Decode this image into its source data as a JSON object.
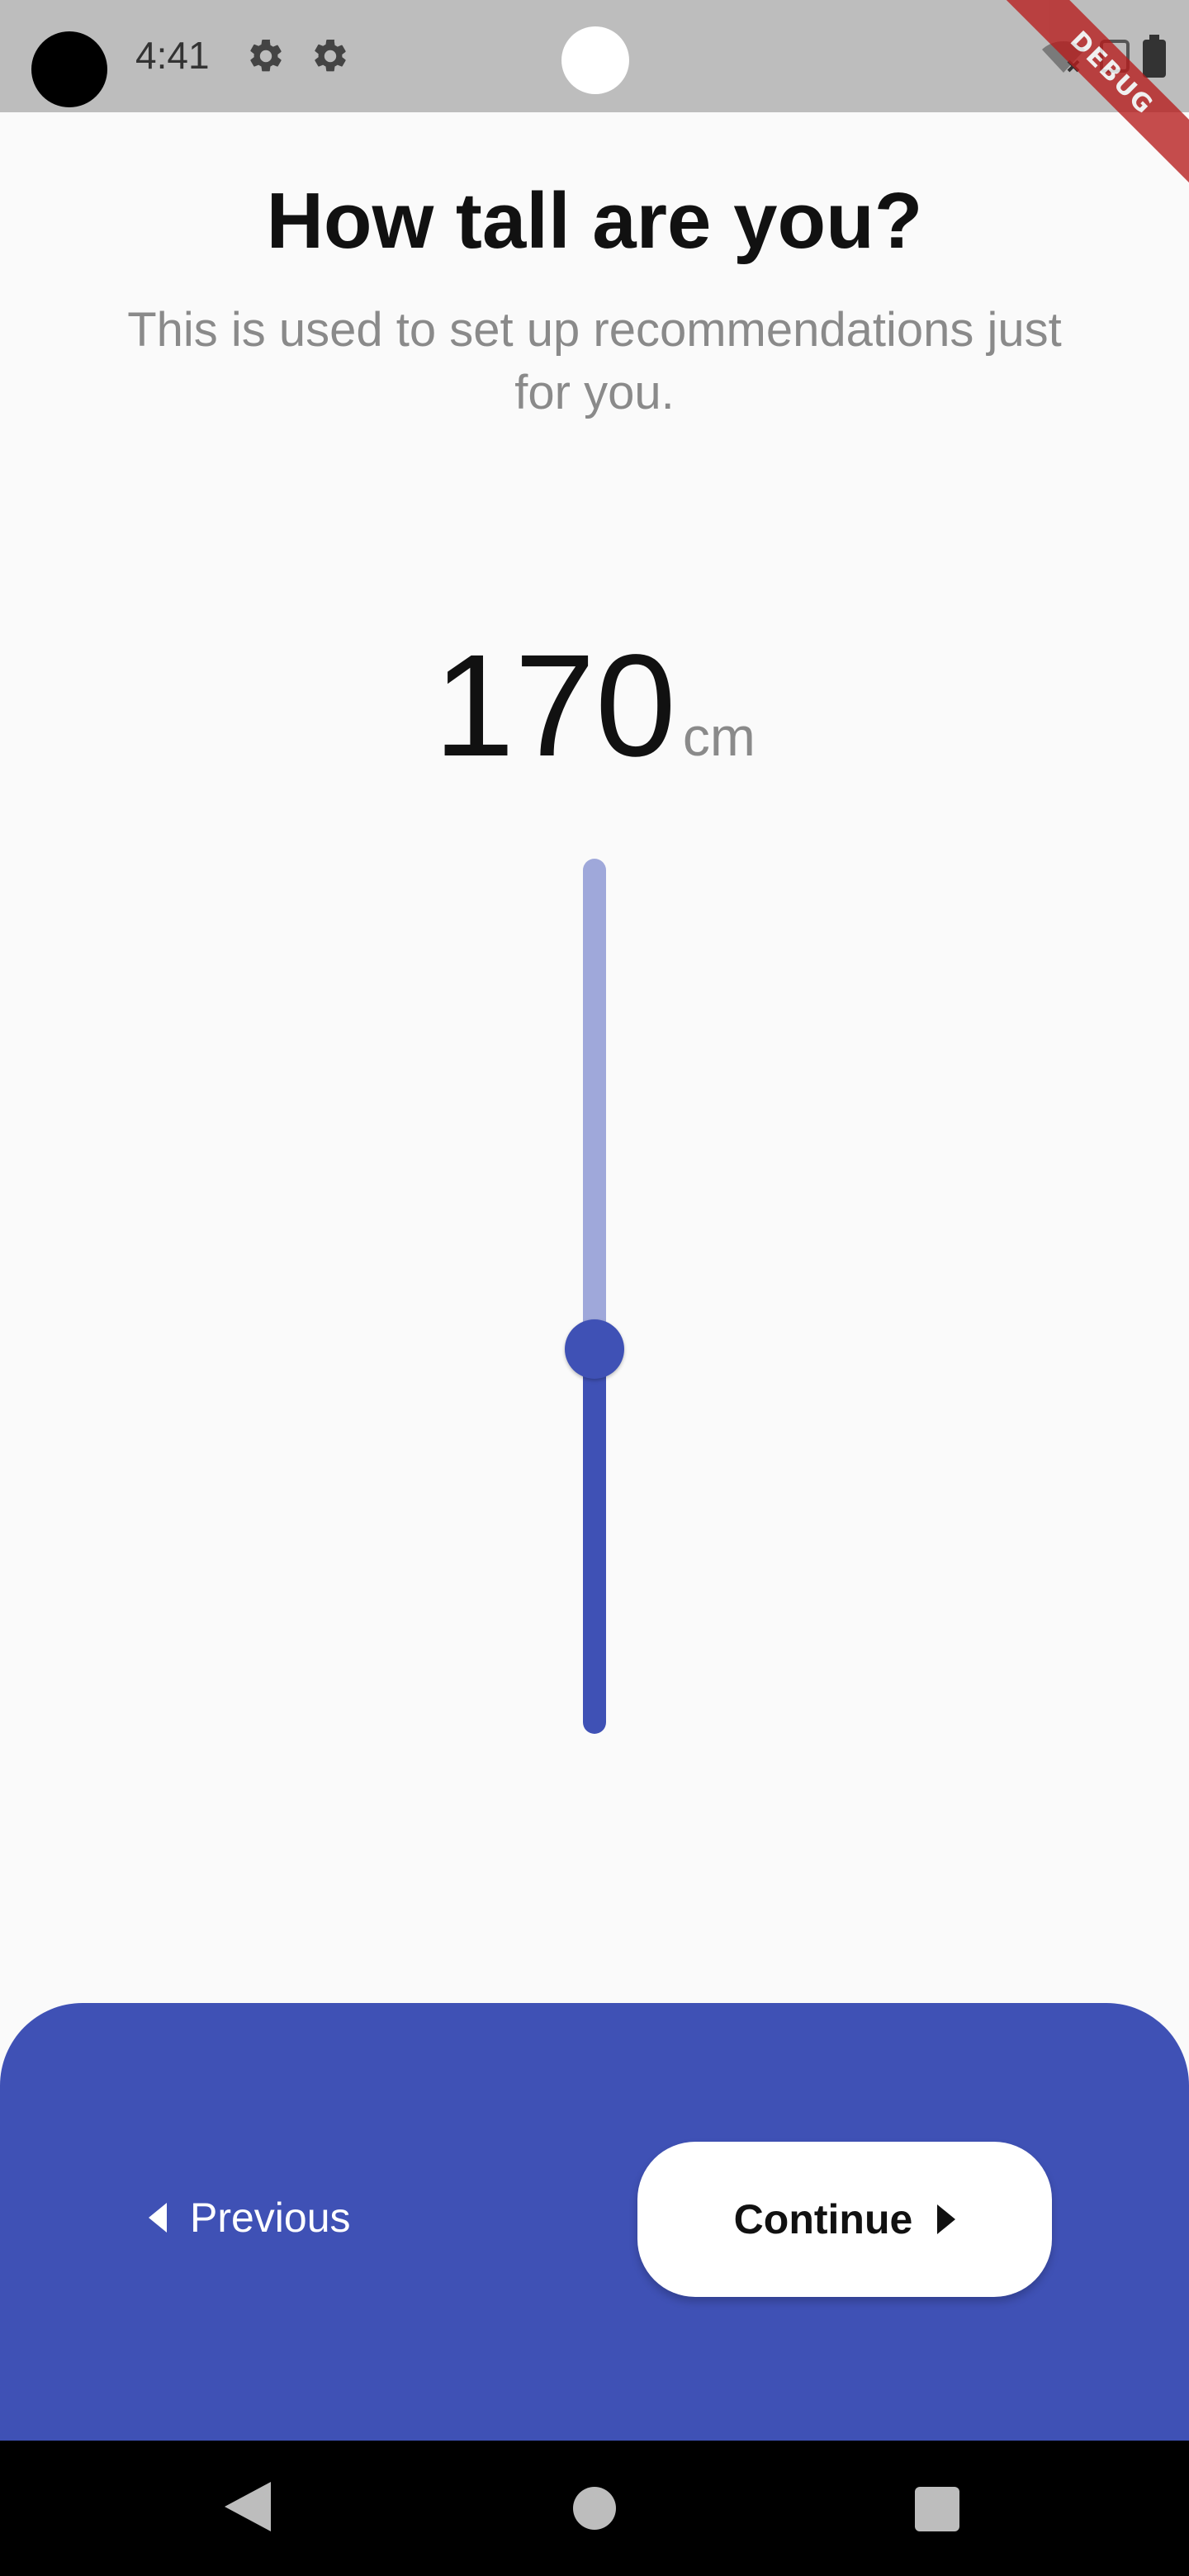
{
  "status_bar": {
    "time": "4:41",
    "icons": [
      "gear-icon",
      "gear-icon",
      "wifi-off-icon",
      "screenshot-icon",
      "battery-icon"
    ],
    "debug_label": "DEBUG"
  },
  "header": {
    "title": "How tall are you?",
    "subtitle": "This is used to set up recommendations just for you."
  },
  "height": {
    "value": "170",
    "unit": "cm"
  },
  "slider": {
    "orientation": "vertical",
    "fraction": 0.44,
    "active_color": "#3f51b5",
    "inactive_color": "#9fa8da"
  },
  "footer": {
    "previous_label": "Previous",
    "continue_label": "Continue",
    "panel_color": "#3f51b5"
  },
  "nav_bar": {
    "icons": [
      "back-icon",
      "home-icon",
      "recents-icon"
    ]
  }
}
